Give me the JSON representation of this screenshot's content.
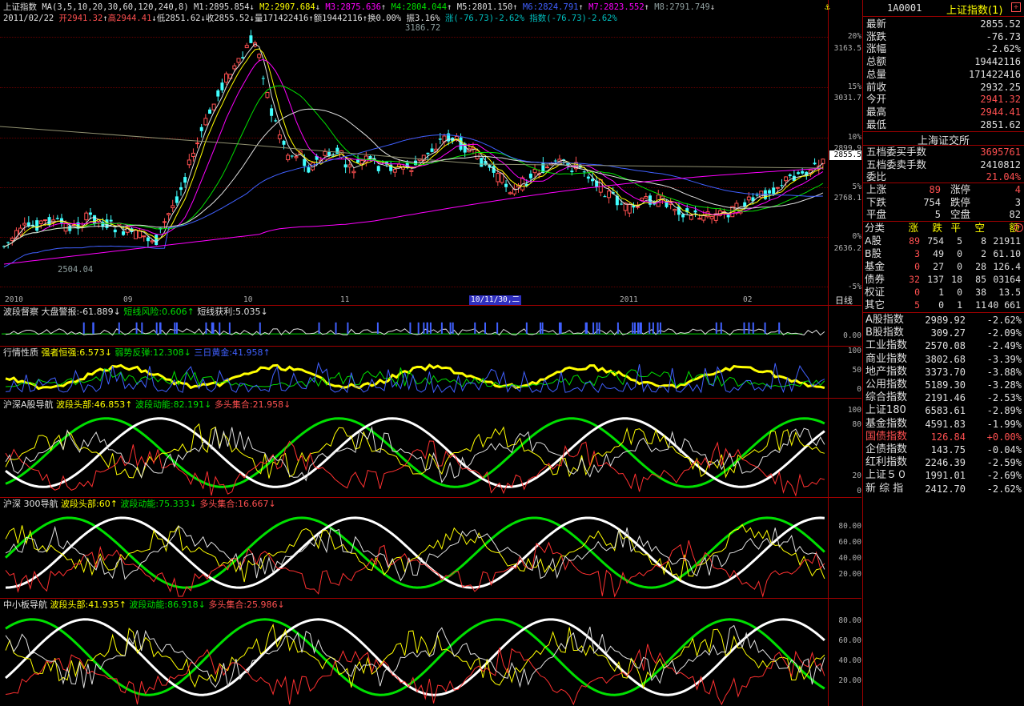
{
  "header": {
    "index_name": "上证指数",
    "ma_label": "MA(3,5,10,20,30,60,120,240,8)",
    "ma": [
      {
        "t": "M1:2895.854",
        "a": "↓",
        "c": "#e0e0e0"
      },
      {
        "t": "M2:2907.684",
        "a": "↓",
        "c": "#ffff00"
      },
      {
        "t": "M3:2875.636",
        "a": "↑",
        "c": "#ff00ff"
      },
      {
        "t": "M4:2804.044",
        "a": "↑",
        "c": "#00e000"
      },
      {
        "t": "M5:2801.150",
        "a": "↑",
        "c": "#e0e0e0"
      },
      {
        "t": "M6:2824.791",
        "a": "↑",
        "c": "#4060ff"
      },
      {
        "t": "M7:2823.552",
        "a": "↑",
        "c": "#ff00ff"
      },
      {
        "t": "M8:2791.749",
        "a": "↓",
        "c": "#90a0a0"
      }
    ],
    "date": "2011/02/22",
    "open": "开2941.32",
    "high": "高2944.41",
    "low": "低2851.62",
    "close": "收2855.52",
    "vol": "量171422416",
    "amt": "额19442116",
    "turn": "换0.00%",
    "amp": "振3.16%",
    "chg": "涨(-76.73)-2.62%",
    "idx": "指数(-76.73)-2.62%"
  },
  "main_axis": {
    "pct": [
      "20%",
      "15%",
      "10%",
      "5%",
      "0%",
      "-5%"
    ],
    "prices": [
      "3163.5",
      "3031.7",
      "2899.9",
      "2768.1",
      "2636.2"
    ],
    "current_price": "2855.5"
  },
  "annotations": {
    "peak": "3186.72",
    "trough": "2504.04"
  },
  "date_axis": {
    "labels": [
      "2010",
      "09",
      "10",
      "11",
      "10/11/30,二",
      "2011",
      "02"
    ],
    "period": "日线"
  },
  "panel1": {
    "name": "波段督察",
    "items": [
      {
        "t": "大盘警报:-61.889↓",
        "c": "#e0e0e0"
      },
      {
        "t": "短线风险:0.606↑",
        "c": "#00e000"
      },
      {
        "t": "短线获利:5.035↓",
        "c": "#e0e0e0"
      }
    ],
    "axis": [
      "0.00"
    ]
  },
  "panel2": {
    "name": "行情性质",
    "items": [
      {
        "t": "强者恒强:6.573↓",
        "c": "#ffff00"
      },
      {
        "t": "弱势反弹:12.308↓",
        "c": "#00e000"
      },
      {
        "t": "三日黄金:41.958↑",
        "c": "#4060ff"
      }
    ],
    "axis": [
      "100",
      "50",
      "0"
    ]
  },
  "panel3": {
    "name": "沪深A股导航",
    "items": [
      {
        "t": "波段头部:46.853↑",
        "c": "#ffff00"
      },
      {
        "t": "波段动能:82.191↓",
        "c": "#00e000"
      },
      {
        "t": "多头集合:21.958↓",
        "c": "#ff5050"
      }
    ],
    "axis": [
      "100",
      "80",
      "20",
      "0"
    ]
  },
  "panel4": {
    "name": "沪深 300导航",
    "items": [
      {
        "t": "波段头部:60↑",
        "c": "#ffff00"
      },
      {
        "t": "波段动能:75.333↓",
        "c": "#00e000"
      },
      {
        "t": "多头集合:16.667↓",
        "c": "#ff5050"
      }
    ],
    "axis": [
      "80.00",
      "60.00",
      "40.00",
      "20.00"
    ]
  },
  "panel5": {
    "name": "中小板导航",
    "items": [
      {
        "t": "波段头部:41.935↑",
        "c": "#ffff00"
      },
      {
        "t": "波段动能:86.918↓",
        "c": "#00e000"
      },
      {
        "t": "多头集合:25.986↓",
        "c": "#ff5050"
      }
    ],
    "axis": [
      "80.00",
      "60.00",
      "40.00",
      "20.00"
    ]
  },
  "side": {
    "code": "1A0001",
    "title": "上证指数(1)",
    "quote": [
      {
        "k": "最新",
        "v": "2855.52",
        "c": "#e0e0e0"
      },
      {
        "k": "涨跌",
        "v": "-76.73",
        "c": "#e0e0e0"
      },
      {
        "k": "涨幅",
        "v": "-2.62%",
        "c": "#e0e0e0"
      },
      {
        "k": "总额",
        "v": "19442116",
        "c": "#e0e0e0"
      },
      {
        "k": "总量",
        "v": "171422416",
        "c": "#e0e0e0"
      },
      {
        "k": "前收",
        "v": "2932.25",
        "c": "#e0e0e0"
      },
      {
        "k": "今开",
        "v": "2941.32",
        "c": "#ff5050"
      },
      {
        "k": "最高",
        "v": "2944.41",
        "c": "#ff5050"
      },
      {
        "k": "最低",
        "v": "2851.62",
        "c": "#e0e0e0"
      }
    ],
    "exchange": "上海证交所",
    "book": [
      {
        "k": "五档委买手数",
        "v": "3695761",
        "c": "#ff5050"
      },
      {
        "k": "五档委卖手数",
        "v": "2410812",
        "c": "#e0e0e0"
      },
      {
        "k": "委比",
        "v": "21.04%",
        "c": "#ff5050"
      }
    ],
    "breadth": [
      {
        "k1": "上涨",
        "v1": "89",
        "c1": "#ff5050",
        "k2": "涨停",
        "v2": "4",
        "c2": "#ff5050"
      },
      {
        "k1": "下跌",
        "v1": "754",
        "c1": "#e0e0e0",
        "k2": "跌停",
        "v2": "3",
        "c2": "#e0e0e0"
      },
      {
        "k1": "平盘",
        "v1": "5",
        "c1": "#e0e0e0",
        "k2": "空盘",
        "v2": "82",
        "c2": "#e0e0e0"
      }
    ],
    "table_head": {
      "name": "分类",
      "cols": [
        "涨",
        "跌",
        "平",
        "空",
        "额"
      ]
    },
    "table": [
      {
        "n": "A股",
        "v": [
          "89",
          "754",
          "5",
          "8",
          "21911"
        ]
      },
      {
        "n": "B股",
        "v": [
          "3",
          "49",
          "0",
          "2",
          "61.10"
        ]
      },
      {
        "n": "基金",
        "v": [
          "0",
          "27",
          "0",
          "28",
          "126.4"
        ]
      },
      {
        "n": "债券",
        "v": [
          "32",
          "137",
          "18",
          "85",
          "03164"
        ]
      },
      {
        "n": "权证",
        "v": [
          "0",
          "1",
          "0",
          "38",
          "13.5"
        ]
      },
      {
        "n": "其它",
        "v": [
          "5",
          "0",
          "1",
          "11",
          "40 661"
        ]
      }
    ],
    "indices": [
      {
        "n": "A股指数",
        "p": "2989.92",
        "q": "-2.62%",
        "c": "#e0e0e0"
      },
      {
        "n": "B股指数",
        "p": "309.27",
        "q": "-2.09%",
        "c": "#e0e0e0"
      },
      {
        "n": "工业指数",
        "p": "2570.08",
        "q": "-2.49%",
        "c": "#e0e0e0"
      },
      {
        "n": "商业指数",
        "p": "3802.68",
        "q": "-3.39%",
        "c": "#e0e0e0"
      },
      {
        "n": "地产指数",
        "p": "3373.70",
        "q": "-3.88%",
        "c": "#e0e0e0"
      },
      {
        "n": "公用指数",
        "p": "5189.30",
        "q": "-3.28%",
        "c": "#e0e0e0"
      },
      {
        "n": "综合指数",
        "p": "2191.46",
        "q": "-2.53%",
        "c": "#e0e0e0"
      },
      {
        "n": "上证180",
        "p": "6583.61",
        "q": "-2.89%",
        "c": "#e0e0e0"
      },
      {
        "n": "基金指数",
        "p": "4591.83",
        "q": "-1.99%",
        "c": "#e0e0e0"
      },
      {
        "n": "国债指数",
        "p": "126.84",
        "q": "+0.00%",
        "c": "#ff5050"
      },
      {
        "n": "企债指数",
        "p": "143.75",
        "q": "-0.04%",
        "c": "#e0e0e0"
      },
      {
        "n": "红利指数",
        "p": "2246.39",
        "q": "-2.59%",
        "c": "#e0e0e0"
      },
      {
        "n": "上证５０",
        "p": "1991.01",
        "q": "-2.69%",
        "c": "#e0e0e0"
      },
      {
        "n": "新 综 指",
        "p": "2412.70",
        "q": "-2.62%",
        "c": "#e0e0e0"
      }
    ]
  }
}
